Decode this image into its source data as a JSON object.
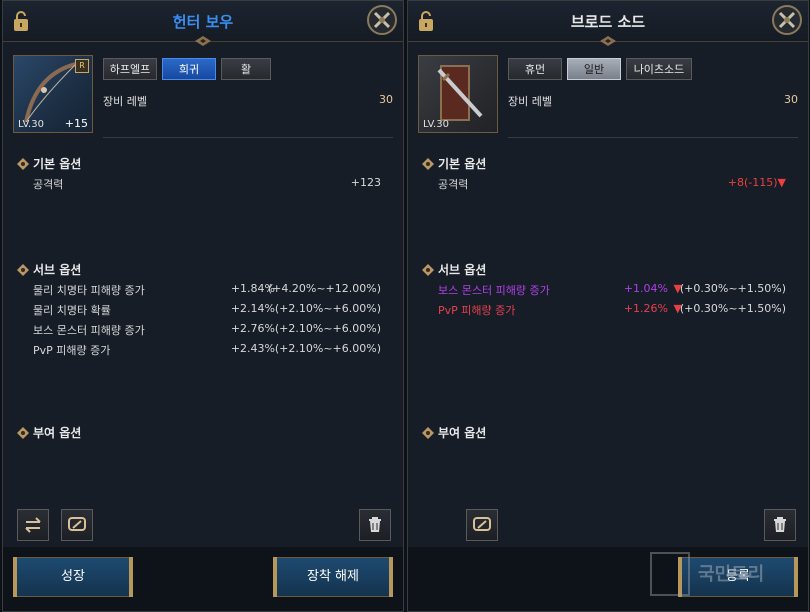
{
  "left": {
    "title": "헌터 보우",
    "title_color": "#3a8ef0",
    "item": {
      "level": "LV.30",
      "enhance": "+15",
      "rank_badge": "R"
    },
    "tags": [
      "하프엘프",
      "희귀",
      "활"
    ],
    "equip_level_label": "장비 레벨",
    "equip_level_value": "30",
    "base_section": "기본 옵션",
    "base_options": [
      {
        "name": "공격력",
        "value": "+123"
      }
    ],
    "sub_section": "서브 옵션",
    "sub_options": [
      {
        "name": "물리 치명타 피해량 증가",
        "value": "+1.84%",
        "range": "(+4.20%~+12.00%)"
      },
      {
        "name": "물리 치명타 확률",
        "value": "+2.14%",
        "range": "(+2.10%~+6.00%)"
      },
      {
        "name": "보스 몬스터 피해량 증가",
        "value": "+2.76%",
        "range": "(+2.10%~+6.00%)"
      },
      {
        "name": "PvP 피해량 증가",
        "value": "+2.43%",
        "range": "(+2.10%~+6.00%)"
      }
    ],
    "grant_section": "부여 옵션",
    "icons": [
      "swap-icon",
      "link-icon",
      "trash-icon"
    ],
    "grow_button": "성장",
    "unequip_button": "장착 해제"
  },
  "right": {
    "title": "브로드 소드",
    "title_color": "#e8e8e8",
    "item": {
      "level": "LV.30"
    },
    "tags": [
      "휴먼",
      "일반",
      "나이츠소드"
    ],
    "equip_level_label": "장비 레벨",
    "equip_level_value": "30",
    "base_section": "기본 옵션",
    "base_options": [
      {
        "name": "공격력",
        "value": "+8(-115)",
        "arrow": "▼"
      }
    ],
    "sub_section": "서브 옵션",
    "sub_options": [
      {
        "name": "보스 몬스터 피해량 증가",
        "value": "+1.04%",
        "arrow": "▼",
        "range": "(+0.30%~+1.50%)",
        "color": "#b040e8"
      },
      {
        "name": "PvP 피해량 증가",
        "value": "+1.26%",
        "arrow": "▼",
        "range": "(+0.30%~+1.50%)",
        "color": "#e84050"
      }
    ],
    "grant_section": "부여 옵션",
    "icons": [
      "link-icon",
      "trash-icon"
    ],
    "register_button": "등록"
  },
  "watermark": "국민트리",
  "colors": {
    "down": "#e84040",
    "accent_gold": "#b8985a"
  }
}
